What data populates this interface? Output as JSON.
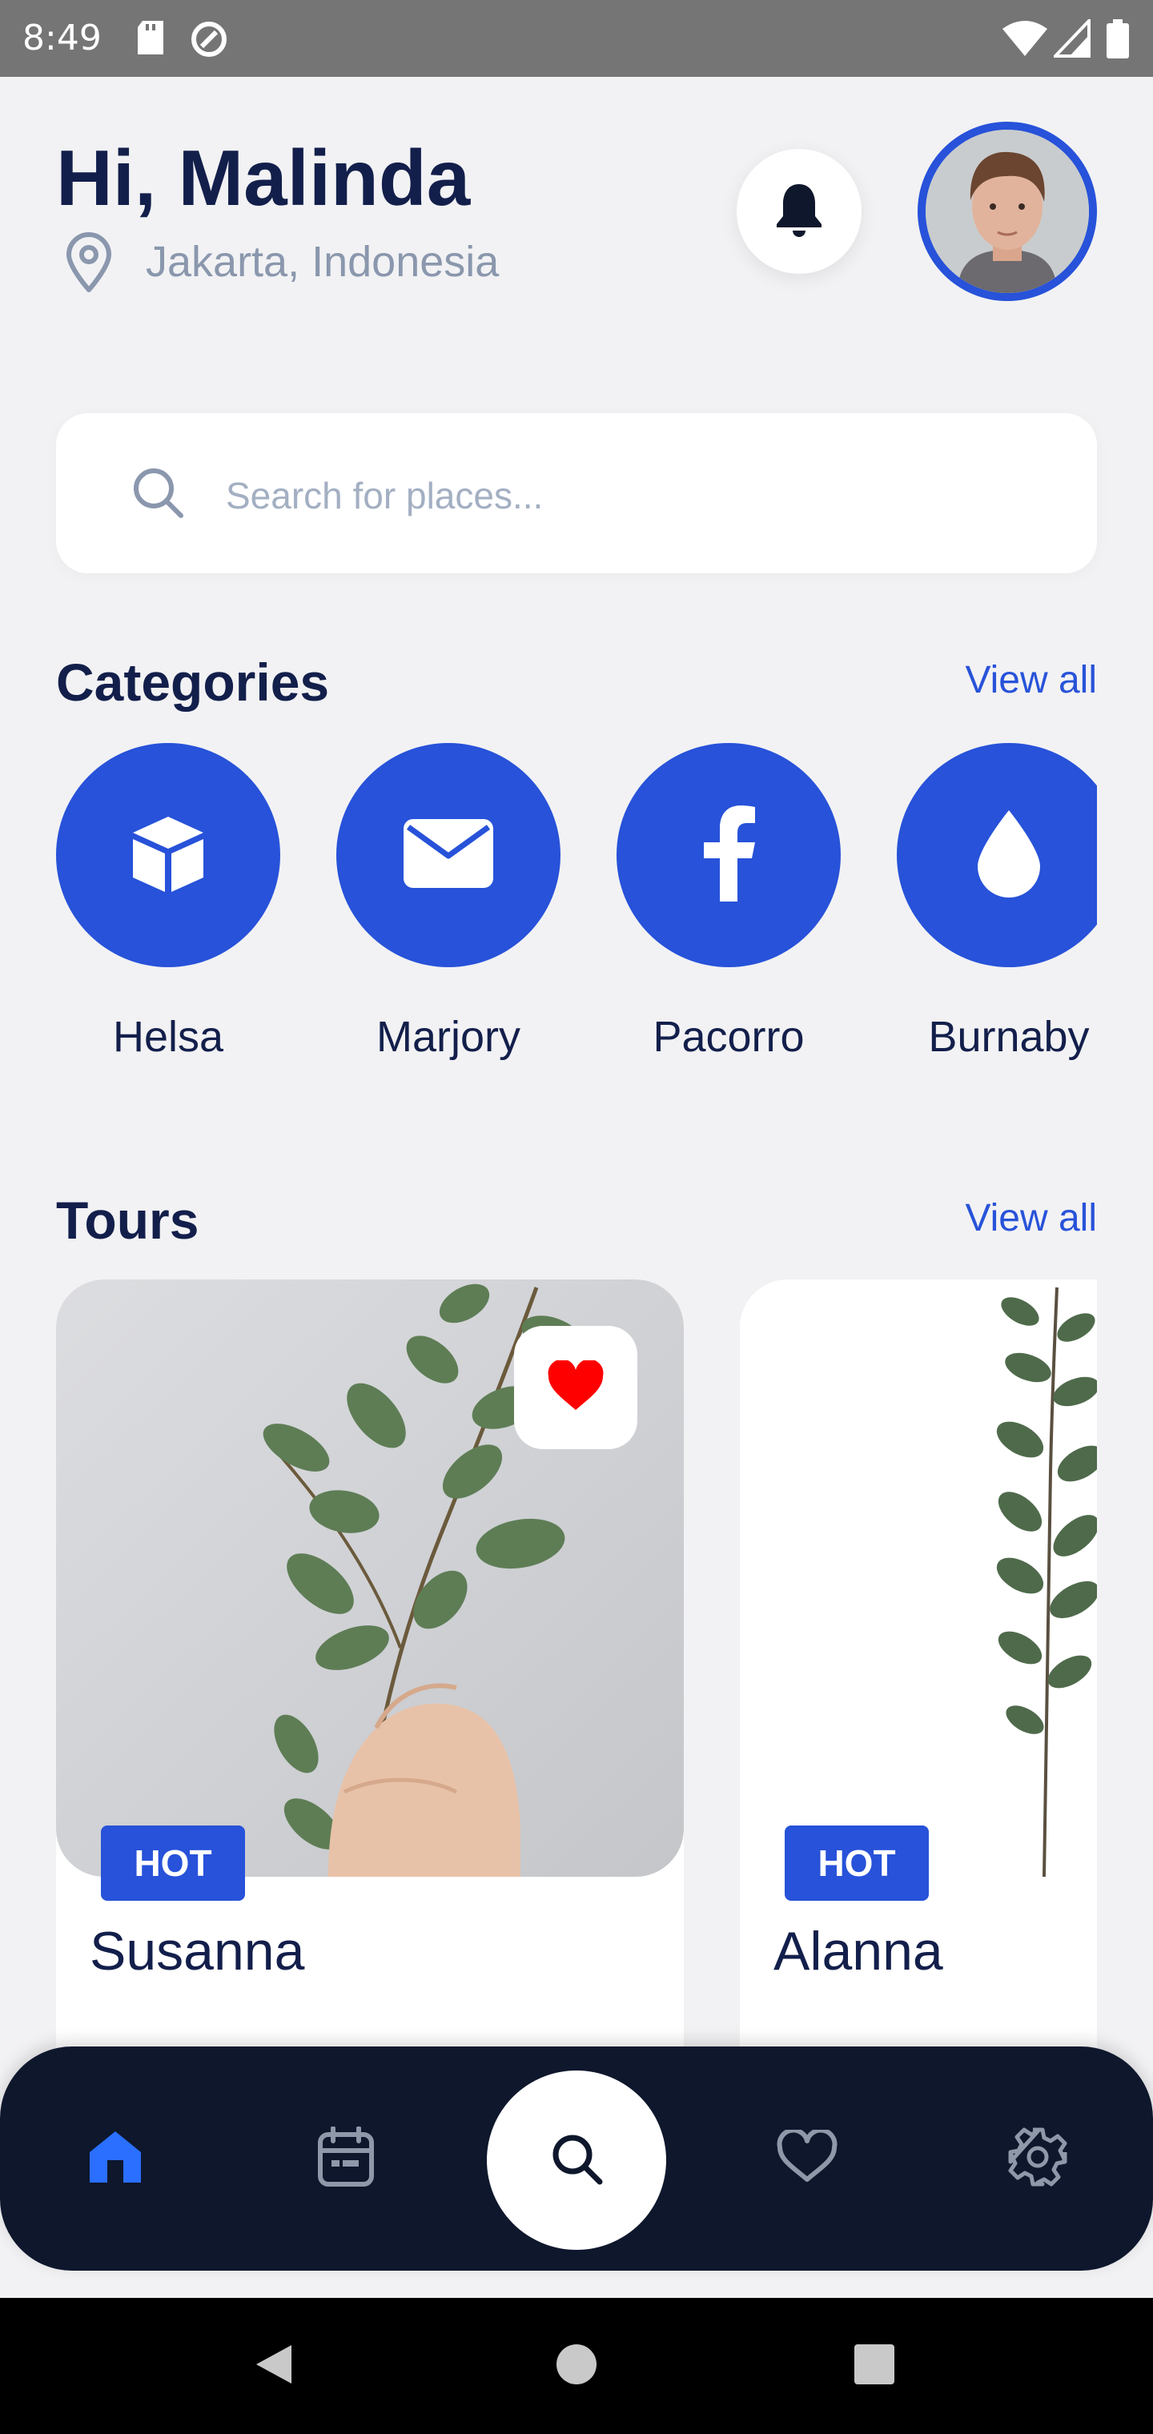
{
  "status_bar": {
    "time": "8:49"
  },
  "header": {
    "greeting": "Hi, Malinda",
    "location": "Jakarta, Indonesia"
  },
  "search": {
    "placeholder": "Search for places..."
  },
  "categories": {
    "title": "Categories",
    "view_all": "View all",
    "items": [
      {
        "label": "Helsa",
        "icon": "box-icon"
      },
      {
        "label": "Marjory",
        "icon": "envelope-icon"
      },
      {
        "label": "Pacorro",
        "icon": "facebook-icon"
      },
      {
        "label": "Burnaby",
        "icon": "droplet-icon"
      }
    ]
  },
  "tours": {
    "title": "Tours",
    "view_all": "View all",
    "items": [
      {
        "name": "Susanna",
        "badge": "HOT",
        "favorited": true
      },
      {
        "name": "Alanna",
        "badge": "HOT"
      }
    ]
  },
  "bottom_nav": {
    "items": [
      "home-icon",
      "calendar-icon",
      "search-icon",
      "heart-icon",
      "settings-icon"
    ],
    "active": "home-icon"
  },
  "colors": {
    "accent": "#2752d9",
    "title": "#131f4b",
    "nav_bg": "#0e172c",
    "heart": "#ff0000"
  }
}
